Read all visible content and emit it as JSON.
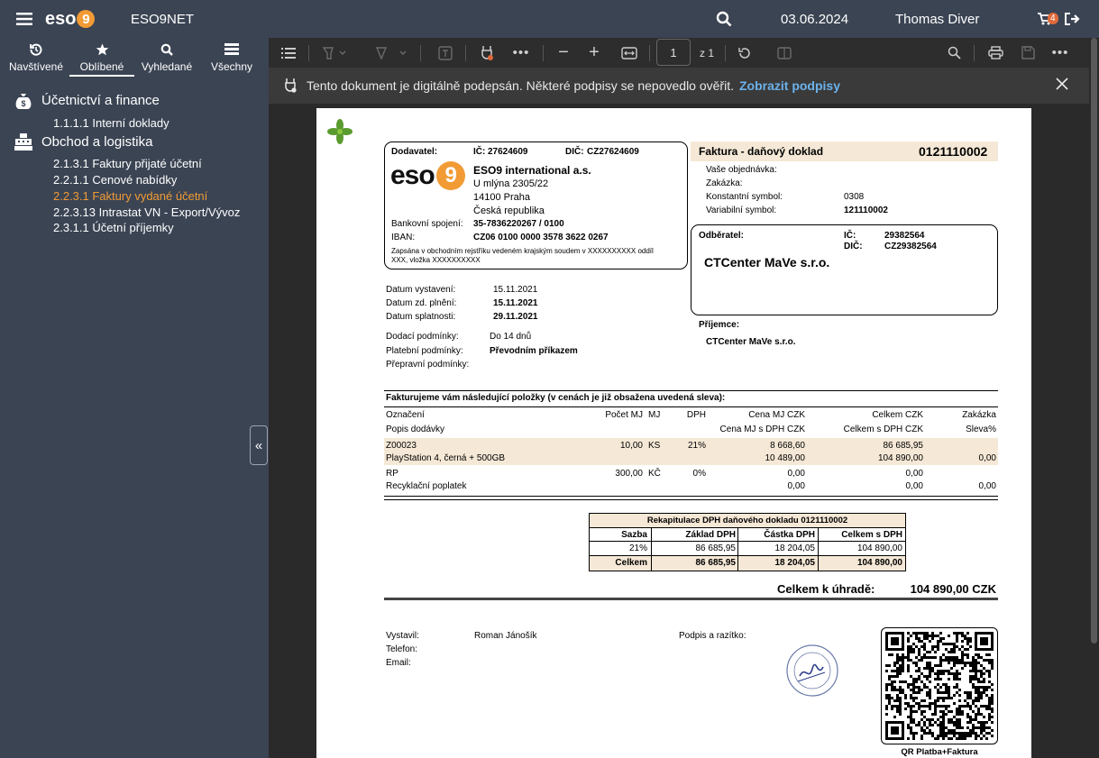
{
  "app": {
    "name": "ESO9NET",
    "date": "03.06.2024",
    "user": "Thomas Diver",
    "notifications": "4",
    "logo_text": "eso",
    "logo_digit": "9"
  },
  "sidebar": {
    "tabs": [
      {
        "label": "Navštívené",
        "icon": "history-icon"
      },
      {
        "label": "Oblíbené",
        "icon": "star-icon"
      },
      {
        "label": "Vyhledané",
        "icon": "search-icon"
      },
      {
        "label": "Všechny",
        "icon": "list-icon"
      }
    ],
    "groups": [
      {
        "label": "Účetnictví a finance",
        "icon": "money-bag-icon",
        "items": [
          {
            "label": "1.1.1.1  Interní doklady"
          }
        ]
      },
      {
        "label": "Obchod a logistika",
        "icon": "cash-register-icon",
        "items": [
          {
            "label": "2.1.3.1  Faktury přijaté účetní"
          },
          {
            "label": "2.2.1.1  Cenové nabídky"
          },
          {
            "label": "2.2.3.1  Faktury vydané účetní"
          },
          {
            "label": "2.2.3.13  Intrastat VN - Export/Vývoz"
          },
          {
            "label": "2.3.1.1  Účetní příjemky"
          }
        ]
      }
    ],
    "active_item": "2.2.3.1  Faktury vydané účetní"
  },
  "toolbar": {
    "page_number": "1",
    "page_count": "z 1"
  },
  "signature_bar": {
    "message": "Tento dokument je digitálně podepsán. Některé podpisy se nepovedlo ověřit.",
    "link": "Zobrazit podpisy"
  },
  "invoice": {
    "supplier_label": "Dodavatel:",
    "supplier_ic_label": "IČ:",
    "supplier_ic": "27624609",
    "supplier_dic_label": "DIČ:",
    "supplier_dic": "CZ27624609",
    "supplier_name": "ESO9 international a.s.",
    "supplier_street": "U mlýna 2305/22",
    "supplier_city": "14100 Praha",
    "supplier_country": "Česká republika",
    "bank_label": "Bankovní spojení:",
    "bank": "35-7836220267 / 0100",
    "iban_label": "IBAN:",
    "iban": "CZ06 0100 0000 3578 3622 0267",
    "registry_note_1": "Zapsána v obchodním rejstříku vedeném krajským soudem v XXXXXXXXXX oddíl",
    "registry_note_2": "XXX, vložka XXXXXXXXXX",
    "doc_title": "Faktura - daňový doklad",
    "doc_number": "0121110002",
    "order_label": "Vaše objednávka:",
    "contract_label": "Zakázka:",
    "const_symbol_label": "Konstantní symbol:",
    "const_symbol": "0308",
    "var_symbol_label": "Variabilní symbol:",
    "var_symbol": "121110002",
    "customer_label": "Odběratel:",
    "customer_ic_label": "IČ:",
    "customer_ic": "29382564",
    "customer_dic_label": "DIČ:",
    "customer_dic": "CZ29382564",
    "customer_name": "CTCenter MaVe s.r.o.",
    "recipient_label": "Příjemce:",
    "recipient_name": "CTCenter MaVe s.r.o.",
    "issue_date_label": "Datum vystavení:",
    "issue_date": "15.11.2021",
    "tax_date_label": "Datum zd. plnění:",
    "tax_date": "15.11.2021",
    "due_date_label": "Datum splatnosti:",
    "due_date": "29.11.2021",
    "delivery_label": "Dodací podmínky:",
    "delivery": "Do 14 dnů",
    "payment_label": "Platební podmínky:",
    "payment": "Převodním příkazem",
    "transport_label": "Přepravní podmínky:",
    "items_heading": "Fakturujeme vám následující položky (v cenách je již obsažena uvedená sleva):",
    "col_headers": {
      "code": "Označení",
      "qty": "Počet MJ",
      "unit": "MJ",
      "vat": "DPH",
      "price": "Cena MJ CZK",
      "total": "Celkem CZK",
      "disc": "Zakázka",
      "desc": "Popis dodávky",
      "price_vat": "Cena MJ s DPH CZK",
      "total_vat": "Celkem s DPH CZK",
      "disc2": "Sleva%"
    },
    "items": [
      {
        "code": "Z00023",
        "desc": "PlayStation 4, černá + 500GB",
        "qty": "10,00",
        "unit": "KS",
        "vat": "21%",
        "price": "8 668,60",
        "total": "86 685,95",
        "price_vat": "10 489,00",
        "total_vat": "104 890,00",
        "disc": "0,00"
      },
      {
        "code": "RP",
        "desc": "Recyklační poplatek",
        "qty": "300,00",
        "unit": "KČ",
        "vat": "0%",
        "price": "0,00",
        "total": "0,00",
        "price_vat": "0,00",
        "total_vat": "0,00",
        "disc": "0,00"
      }
    ],
    "vat_recap": {
      "title": "Rekapitulace DPH daňového dokladu 0121110002",
      "headers": [
        "Sazba",
        "Základ DPH",
        "Částka DPH",
        "Celkem s DPH"
      ],
      "rows": [
        [
          "21%",
          "86 685,95",
          "18 204,05",
          "104 890,00"
        ]
      ],
      "total": [
        "Celkem",
        "86 685,95",
        "18 204,05",
        "104 890,00"
      ]
    },
    "grand_total_label": "Celkem k úhradě:",
    "grand_total": "104 890,00 CZK",
    "issued_by_label": "Vystavil:",
    "issued_by": "Roman Jánošík",
    "phone_label": "Telefon:",
    "email_label": "Email:",
    "signature_label": "Podpis a razítko:",
    "qr_label": "QR Platba+Faktura"
  }
}
